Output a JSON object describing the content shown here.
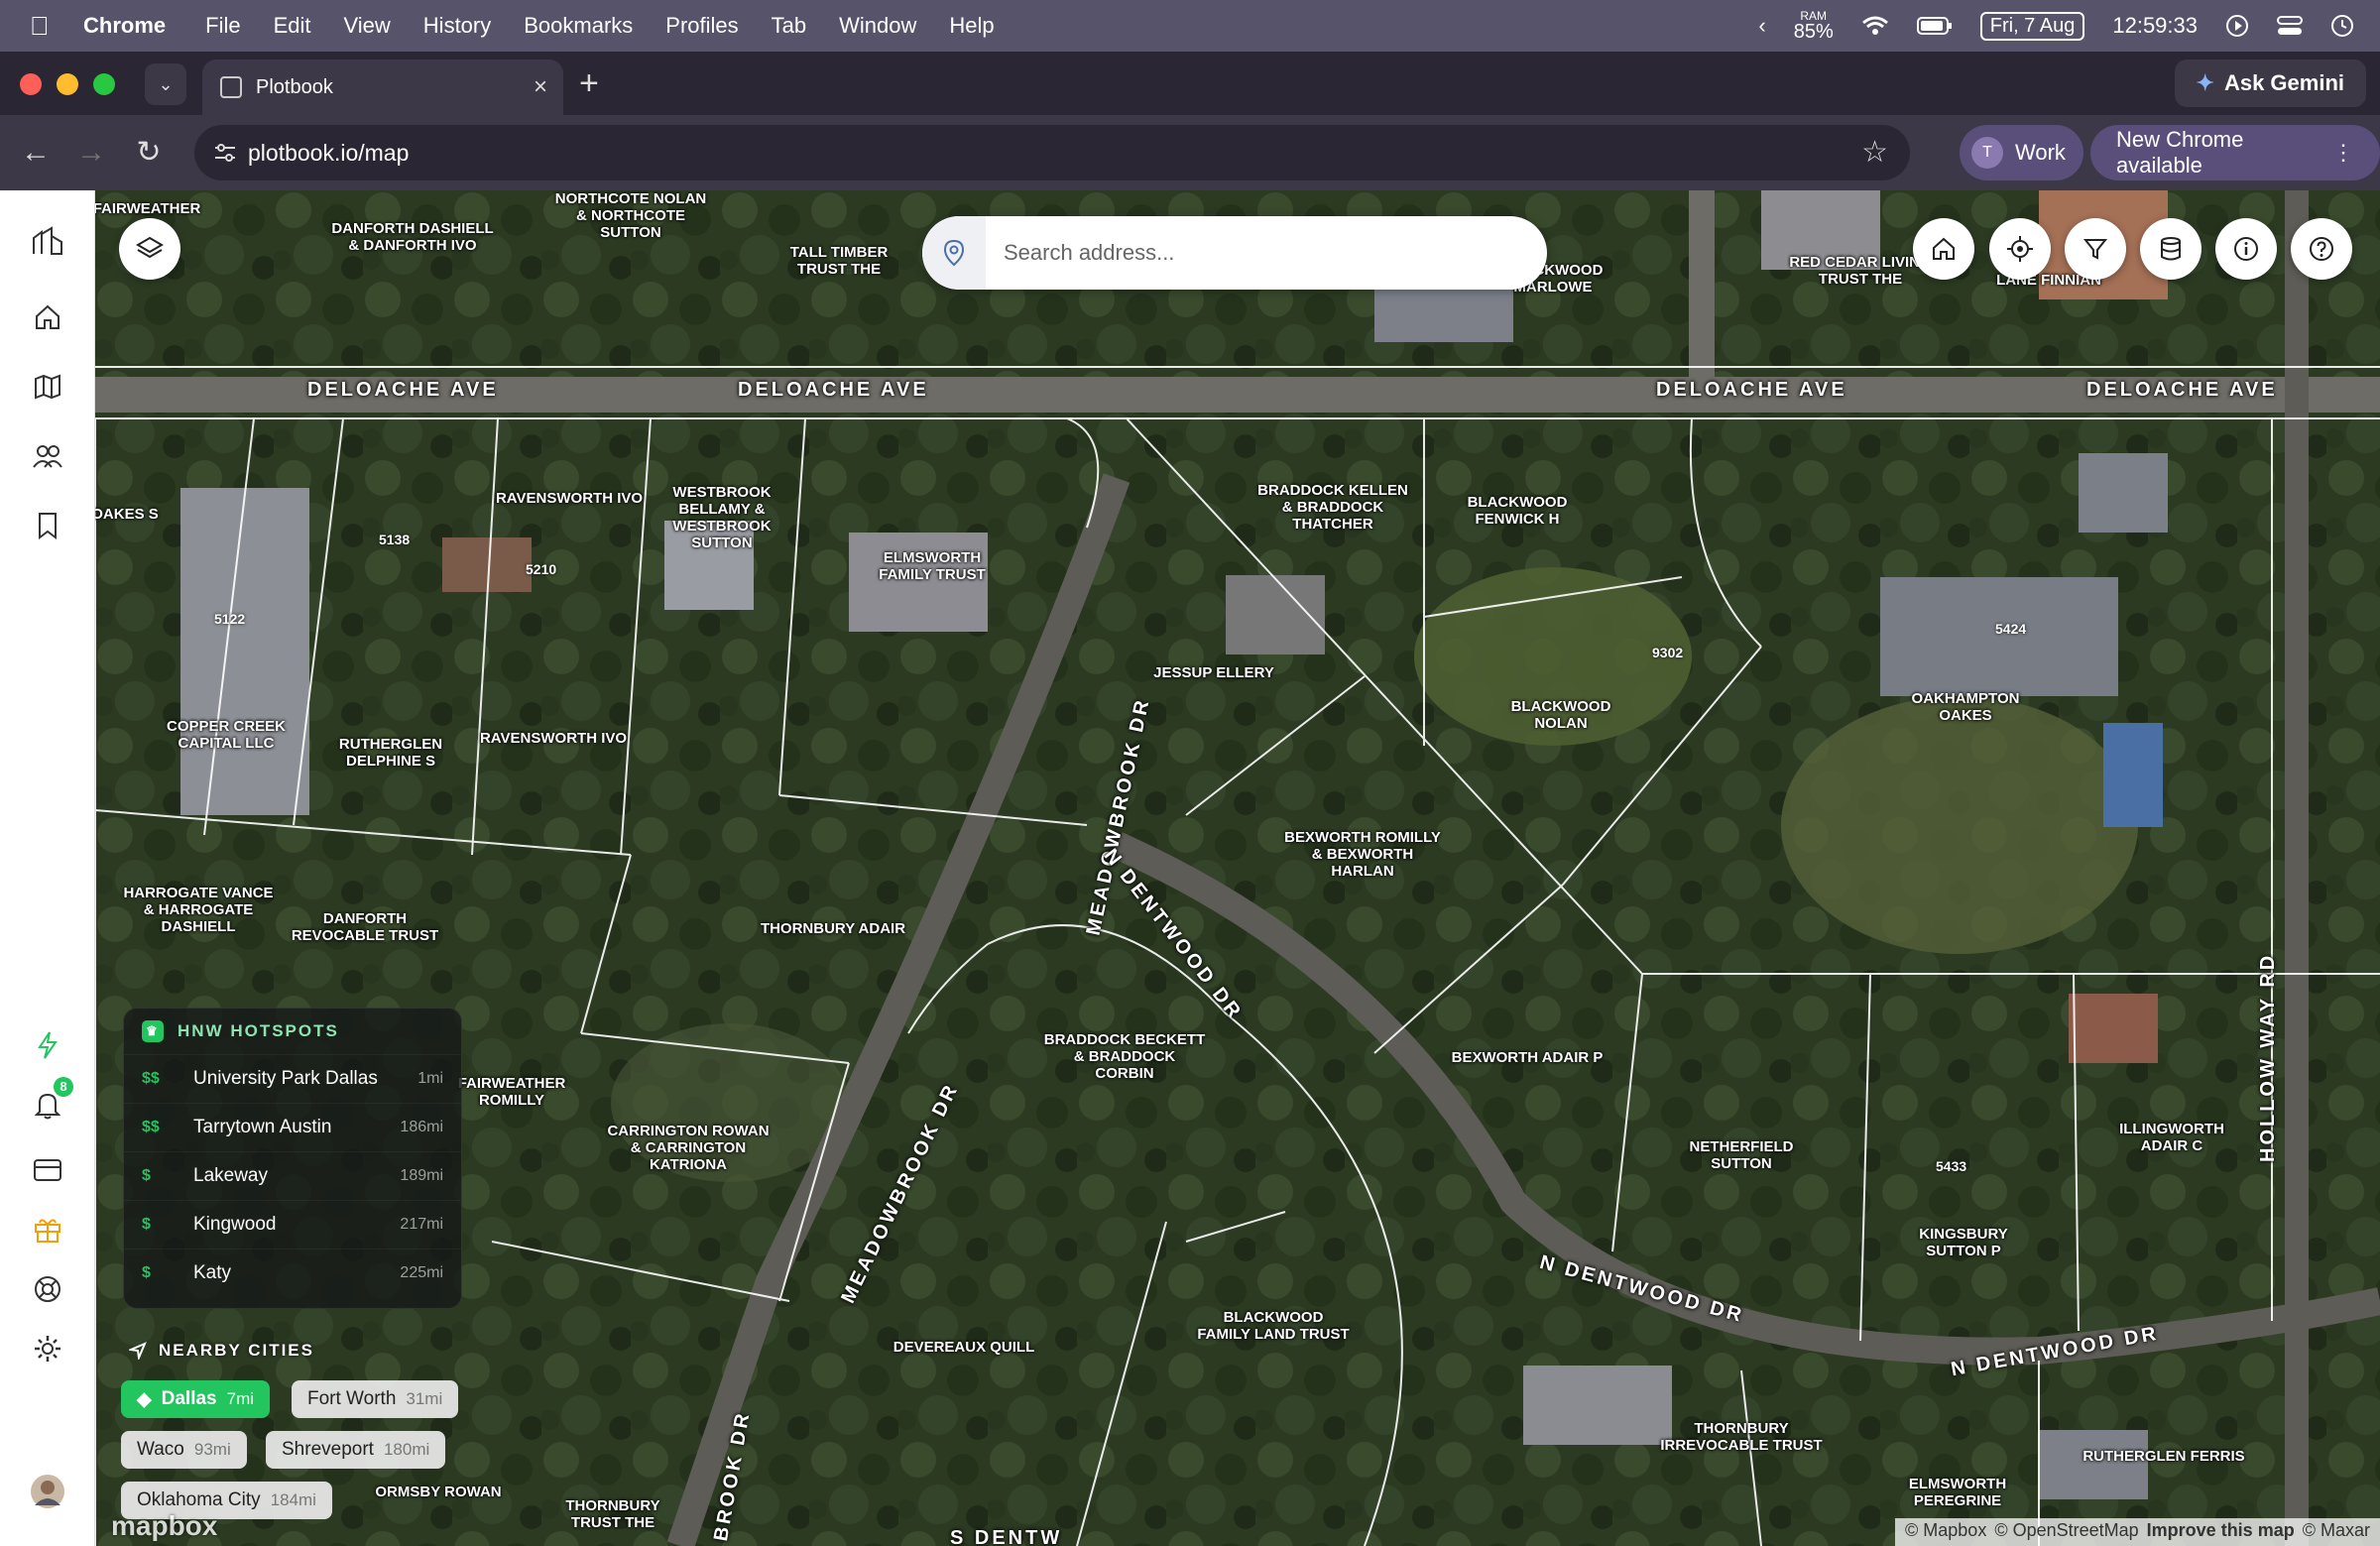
{
  "menubar": {
    "app_name": "Chrome",
    "items": [
      "File",
      "Edit",
      "View",
      "History",
      "Bookmarks",
      "Profiles",
      "Tab",
      "Window",
      "Help"
    ],
    "ram_label": "RAM",
    "ram_value": "85%",
    "date": "Fri, 7 Aug",
    "time": "12:59:33"
  },
  "browser": {
    "tab_title": "Plotbook",
    "url": "plotbook.io/map",
    "ask_gemini": "Ask Gemini",
    "profile_initial": "T",
    "profile_name": "Work",
    "update_label": "New Chrome available"
  },
  "search": {
    "placeholder": "Search address..."
  },
  "streets": [
    "DELOACHE AVE",
    "DELOACHE AVE",
    "DELOACHE AVE",
    "DELOACHE AVE",
    "MEADOWBROOK DR",
    "MEADOWBROOK DR",
    "N DENTWOOD DR",
    "N DENTWOOD DR",
    "N DENTWOOD DR",
    "HOLLOW WAY RD",
    "S DENTW",
    "BROOK DR"
  ],
  "parcels": [
    "FAIRWEATHER",
    "DANFORTH DASHIELL\n& DANFORTH IVO",
    "NORTHCOTE NOLAN\n& NORTHCOTE\nSUTTON",
    "TALL TIMBER\nTRUST THE",
    "BLACKWOOD\nMARLOWE",
    "RED CEDAR LIVING\nTRUST THE",
    "LANE FINNIAN",
    "RAVENSWORTH IVO",
    "WESTBROOK\nBELLAMY &\nWESTBROOK\nSUTTON",
    "ELMSWORTH\nFAMILY TRUST",
    "BRADDOCK KELLEN\n& BRADDOCK\nTHATCHER",
    "BLACKWOOD\nFENWICK H",
    "JESSUP ELLERY",
    "BLACKWOOD\nNOLAN",
    "OAKHAMPTON\nOAKES",
    "COPPER CREEK\nCAPITAL LLC",
    "RUTHERGLEN\nDELPHINE S",
    "RAVENSWORTH IVO",
    "BEXWORTH ROMILLY\n& BEXWORTH\nHARLAN",
    "HARROGATE VANCE\n& HARROGATE\nDASHIELL",
    "DANFORTH\nREVOCABLE TRUST",
    "THORNBURY ADAIR",
    "BRADDOCK BECKETT\n& BRADDOCK\nCORBIN",
    "BEXWORTH ADAIR P",
    "FAIRWEATHER\nROMILLY",
    "CARRINGTON ROWAN\n& CARRINGTON\nKATRIONA",
    "NETHERFIELD\nSUTTON",
    "ILLINGWORTH\nADAIR C",
    "KINGSBURY\nSUTTON P",
    "BLACKWOOD\nFAMILY LAND TRUST",
    "DEVEREAUX QUILL",
    "THORNBURY\nIRREVOCABLE TRUST",
    "ELMSWORTH\nPEREGRINE",
    "RUTHERGLEN FERRIS",
    "ORMSBY ROWAN",
    "THORNBURY\nTRUST THE",
    "OAKES S"
  ],
  "house_numbers": [
    "5138",
    "5210",
    "5122",
    "9302",
    "5424",
    "5433"
  ],
  "hotspots": {
    "title": "HNW HOTSPOTS",
    "rows": [
      {
        "tier": "$$",
        "name": "University Park Dallas",
        "distance": "1mi"
      },
      {
        "tier": "$$",
        "name": "Tarrytown Austin",
        "distance": "186mi"
      },
      {
        "tier": "$",
        "name": "Lakeway",
        "distance": "189mi"
      },
      {
        "tier": "$",
        "name": "Kingwood",
        "distance": "217mi"
      },
      {
        "tier": "$",
        "name": "Katy",
        "distance": "225mi"
      }
    ]
  },
  "nearby": {
    "title": "NEARBY CITIES",
    "cities": [
      {
        "name": "Dallas",
        "distance": "7mi",
        "active": true
      },
      {
        "name": "Fort Worth",
        "distance": "31mi"
      },
      {
        "name": "Waco",
        "distance": "93mi"
      },
      {
        "name": "Shreveport",
        "distance": "180mi"
      },
      {
        "name": "Oklahoma City",
        "distance": "184mi"
      }
    ]
  },
  "sidebar": {
    "notification_count": "8"
  },
  "attribution": {
    "mapbox": "© Mapbox",
    "osm": "© OpenStreetMap",
    "improve": "Improve this map",
    "maxar": "© Maxar"
  },
  "logo": "mapbox",
  "colors": {
    "accent": "#22c55e",
    "menubar": "#56536a",
    "browser_frame": "#3d3847"
  }
}
